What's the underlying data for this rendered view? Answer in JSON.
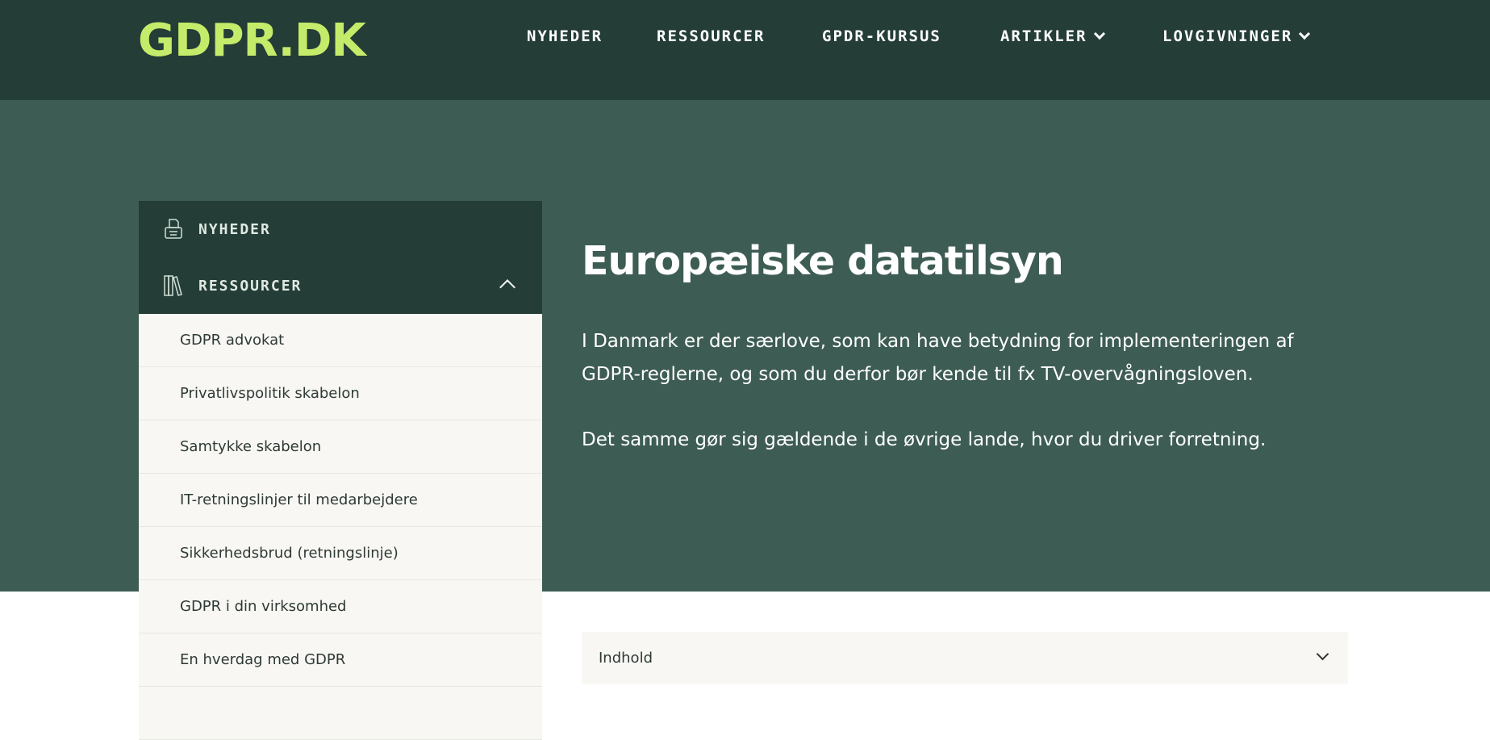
{
  "header": {
    "logo": "GDPR.DK",
    "nav": [
      {
        "label": "NYHEDER",
        "dropdown": false
      },
      {
        "label": "RESSOURCER",
        "dropdown": false
      },
      {
        "label": "GPDR-KURSUS",
        "dropdown": false
      },
      {
        "label": "ARTIKLER",
        "dropdown": true
      },
      {
        "label": "LOVGIVNINGER",
        "dropdown": true
      }
    ]
  },
  "sidebar": {
    "sections": [
      {
        "label": "NYHEDER",
        "icon": "typewriter-icon"
      },
      {
        "label": "RESSOURCER",
        "icon": "books-icon",
        "expanded": true
      }
    ],
    "items": [
      "GDPR advokat",
      "Privatlivspolitik skabelon",
      "Samtykke skabelon",
      "IT-retningslinjer til medarbejdere",
      "Sikkerhedsbrud (retningslinje)",
      "GDPR i din virksomhed",
      "En hverdag med GDPR"
    ]
  },
  "main": {
    "title": "Europæiske datatilsyn",
    "paragraphs": [
      "I Danmark er der særlove, som kan have betydning for implementeringen af GDPR-reglerne, og som du derfor bør kende til fx TV-overvågningsloven.",
      "Det samme gør sig gældende i de øvrige lande, hvor du driver forretning."
    ],
    "toc_label": "Indhold"
  },
  "colors": {
    "header": "#243d37",
    "hero": "#3d5c53",
    "logo": "#c5eb6a",
    "submenu": "#f8f7f3"
  }
}
